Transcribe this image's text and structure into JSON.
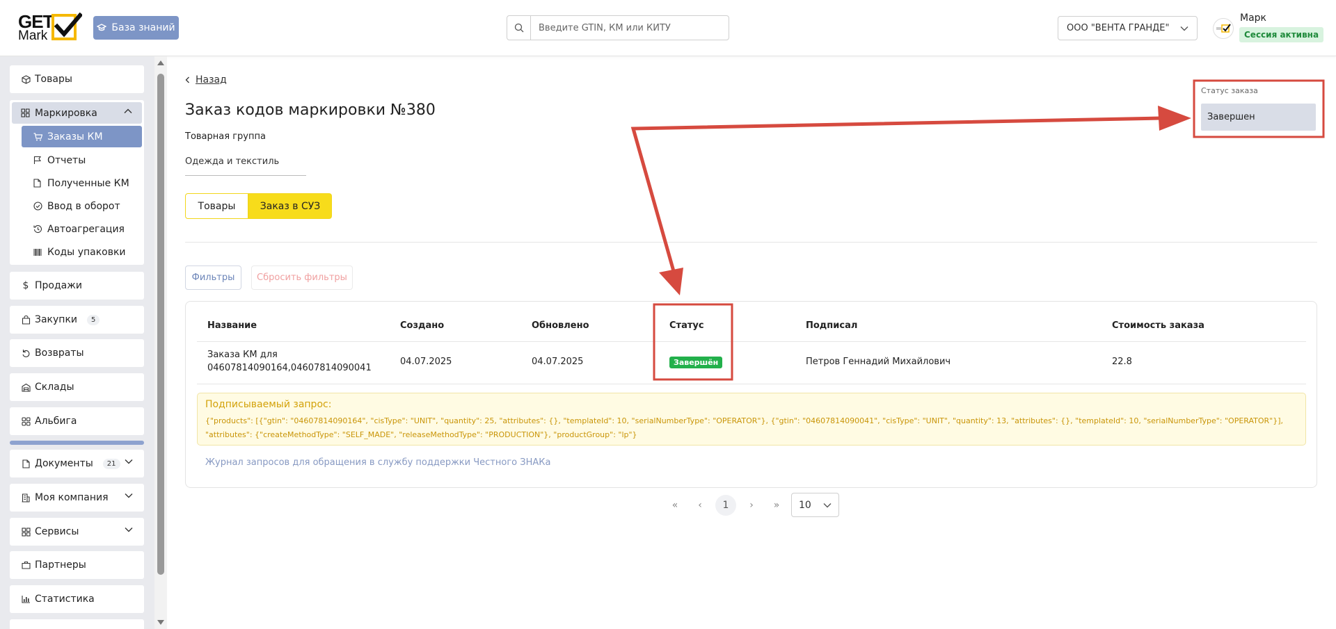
{
  "header": {
    "logo_top": "GET",
    "logo_bottom": "Mark",
    "knowledge_base_label": "База знаний",
    "search_placeholder": "Введите GTIN, КМ или КИТУ",
    "org_name": "ООО \"ВЕНТА ГРАНДЕ\"",
    "user_name": "Марк",
    "session_status": "Сессия активна"
  },
  "sidebar": {
    "goods": "Товары",
    "marking": {
      "label": "Маркировка",
      "items": [
        "Заказы КМ",
        "Отчеты",
        "Полученные КМ",
        "Ввод в оборот",
        "Автоагрегация",
        "Коды упаковки"
      ]
    },
    "sales": "Продажи",
    "purchases": "Закупки",
    "purchases_badge": "5",
    "returns": "Возвраты",
    "warehouses": "Склады",
    "albiga": "Альбига",
    "documents": "Документы",
    "documents_badge": "21",
    "my_company": "Моя компания",
    "services": "Сервисы",
    "partners": "Партнеры",
    "statistics": "Статистика"
  },
  "main": {
    "back_label": "Назад",
    "title": "Заказ кодов маркировки №380",
    "product_group_label": "Товарная группа",
    "product_group_value": "Одежда и текстиль",
    "tabs": [
      "Товары",
      "Заказ в СУЗ"
    ],
    "filters_label": "Фильтры",
    "reset_filters_label": "Сбросить фильтры",
    "table": {
      "headers": [
        "Название",
        "Создано",
        "Обновлено",
        "Статус",
        "Подписал",
        "Стоимость заказа"
      ],
      "row": {
        "name_line1": "Заказа КМ для",
        "name_line2": "04607814090164,04607814090041",
        "created": "04.07.2025",
        "updated": "04.07.2025",
        "status": "Завершён",
        "signed_by": "Петров Геннадий Михайлович",
        "cost": "22.8"
      }
    },
    "signed_request_title": "Подписываемый запрос:",
    "signed_request_body": "{\"products\": [{\"gtin\": \"04607814090164\", \"cisType\": \"UNIT\", \"quantity\": 25, \"attributes\": {}, \"templateId\": 10, \"serialNumberType\": \"OPERATOR\"}, {\"gtin\": \"04607814090041\", \"cisType\": \"UNIT\", \"quantity\": 13, \"attributes\": {}, \"templateId\": 10, \"serialNumberType\": \"OPERATOR\"}], \"attributes\": {\"createMethodType\": \"SELF_MADE\", \"releaseMethodType\": \"PRODUCTION\"}, \"productGroup\": \"lp\"}",
    "journal_link": "Журнал запросов для обращения в службу поддержки Честного ЗНАКа",
    "pagination": {
      "first": "«",
      "prev": "‹",
      "current": "1",
      "next": "›",
      "last": "»",
      "per_page": "10"
    },
    "order_status_label": "Статус заказа",
    "order_status_value": "Завершен"
  },
  "colors": {
    "accent": "#7d95c6",
    "yellow": "#f7dc1b",
    "success": "#22b04b",
    "annotation": "#d64a3f"
  }
}
